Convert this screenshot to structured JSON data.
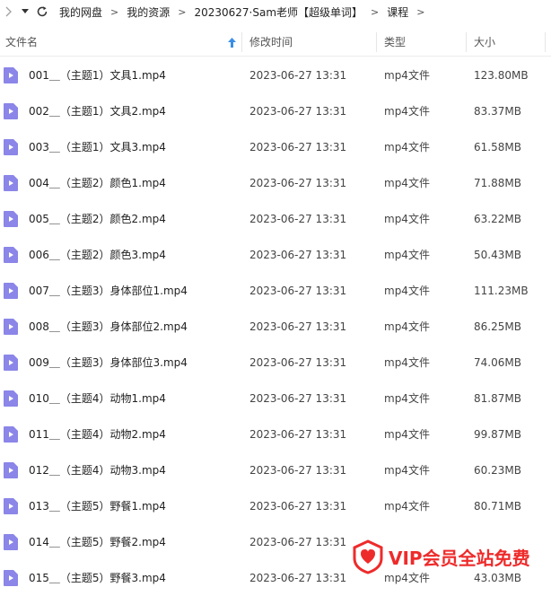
{
  "breadcrumb": [
    "我的网盘",
    "我的资源",
    "20230627·Sam老师【超级单词】",
    "课程"
  ],
  "header": {
    "name": "文件名",
    "date": "修改时间",
    "type": "类型",
    "size": "大小"
  },
  "files": [
    {
      "name": "001＿（主题1）文具1.mp4",
      "date": "2023-06-27 13:31",
      "type": "mp4文件",
      "size": "123.80MB"
    },
    {
      "name": "002＿（主题1）文具2.mp4",
      "date": "2023-06-27 13:31",
      "type": "mp4文件",
      "size": "83.37MB"
    },
    {
      "name": "003＿（主题1）文具3.mp4",
      "date": "2023-06-27 13:31",
      "type": "mp4文件",
      "size": "61.58MB"
    },
    {
      "name": "004＿（主题2）颜色1.mp4",
      "date": "2023-06-27 13:31",
      "type": "mp4文件",
      "size": "71.88MB"
    },
    {
      "name": "005＿（主题2）颜色2.mp4",
      "date": "2023-06-27 13:31",
      "type": "mp4文件",
      "size": "63.22MB"
    },
    {
      "name": "006＿（主题2）颜色3.mp4",
      "date": "2023-06-27 13:31",
      "type": "mp4文件",
      "size": "50.43MB"
    },
    {
      "name": "007＿（主题3）身体部位1.mp4",
      "date": "2023-06-27 13:31",
      "type": "mp4文件",
      "size": "111.23MB"
    },
    {
      "name": "008＿（主题3）身体部位2.mp4",
      "date": "2023-06-27 13:31",
      "type": "mp4文件",
      "size": "86.25MB"
    },
    {
      "name": "009＿（主题3）身体部位3.mp4",
      "date": "2023-06-27 13:31",
      "type": "mp4文件",
      "size": "74.06MB"
    },
    {
      "name": "010＿（主题4）动物1.mp4",
      "date": "2023-06-27 13:31",
      "type": "mp4文件",
      "size": "81.87MB"
    },
    {
      "name": "011＿（主题4）动物2.mp4",
      "date": "2023-06-27 13:31",
      "type": "mp4文件",
      "size": "99.87MB"
    },
    {
      "name": "012＿（主题4）动物3.mp4",
      "date": "2023-06-27 13:31",
      "type": "mp4文件",
      "size": "60.23MB"
    },
    {
      "name": "013＿（主题5）野餐1.mp4",
      "date": "2023-06-27 13:31",
      "type": "mp4文件",
      "size": "80.71MB"
    },
    {
      "name": "014＿（主题5）野餐2.mp4",
      "date": "2023-06-27 13:31",
      "type": "",
      "size": ""
    },
    {
      "name": "015＿（主题5）野餐3.mp4",
      "date": "2023-06-27 13:31",
      "type": "mp4文件",
      "size": "43.03MB"
    }
  ],
  "watermark": {
    "text": "VIP会员全站免费"
  },
  "colors": {
    "file_icon": "#8b86e8",
    "watermark": "#ee2b2b",
    "sort_arrow": "#3a8ee6"
  }
}
